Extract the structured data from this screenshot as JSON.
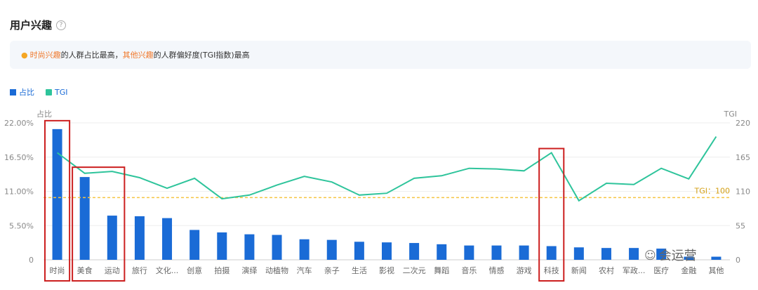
{
  "header": {
    "title": "用户兴趣",
    "help_icon": "question-circle-icon"
  },
  "insight": {
    "icon": "lightbulb-icon",
    "highlight1": "时尚兴趣",
    "text1": "的人群占比最高，",
    "highlight2": "其他兴趣",
    "text2": "的人群偏好度(TGI指数)最高"
  },
  "legend": {
    "bar_label": "占比",
    "line_label": "TGI"
  },
  "colors": {
    "bar": "#1a6bd6",
    "line": "#2ec49b",
    "reference": "#f5c542",
    "annotation_box": "#cc1f1f"
  },
  "watermark": {
    "icon": "wechat-icon",
    "text": "会运营"
  },
  "chart_data": {
    "type": "bar",
    "categories": [
      "时尚",
      "美食",
      "运动",
      "旅行",
      "文化...",
      "创意",
      "拍摄",
      "演绎",
      "动植物",
      "汽车",
      "亲子",
      "生活",
      "影视",
      "二次元",
      "舞蹈",
      "音乐",
      "情感",
      "游戏",
      "科技",
      "新闻",
      "农村",
      "军政...",
      "医疗",
      "金融",
      "其他"
    ],
    "series": [
      {
        "name": "占比",
        "type": "bar",
        "axis": "left",
        "values": [
          21.0,
          13.3,
          7.1,
          7.0,
          6.7,
          4.8,
          4.4,
          4.1,
          4.0,
          3.3,
          3.2,
          2.9,
          2.8,
          2.7,
          2.5,
          2.3,
          2.3,
          2.3,
          2.2,
          2.0,
          1.9,
          1.9,
          1.8,
          0.5,
          0.5
        ]
      },
      {
        "name": "TGI",
        "type": "line",
        "axis": "right",
        "values": [
          172,
          139,
          142,
          132,
          115,
          131,
          98,
          104,
          120,
          134,
          125,
          104,
          107,
          131,
          135,
          147,
          146,
          143,
          172,
          95,
          123,
          121,
          147,
          130,
          198
        ]
      }
    ],
    "ylabel_left": "占比",
    "ylabel_right": "TGI",
    "yticks_left": [
      "0",
      "5.50%",
      "11.00%",
      "16.50%",
      "22.00%"
    ],
    "yticks_right": [
      "0",
      "55",
      "110",
      "165",
      "220"
    ],
    "ylim_left": [
      0,
      22
    ],
    "ylim_right": [
      0,
      220
    ],
    "reference_line": {
      "value": 100,
      "label": "TGI：100"
    },
    "highlighted_categories": [
      [
        "时尚"
      ],
      [
        "美食",
        "运动"
      ],
      [
        "科技"
      ]
    ],
    "grid": true
  }
}
